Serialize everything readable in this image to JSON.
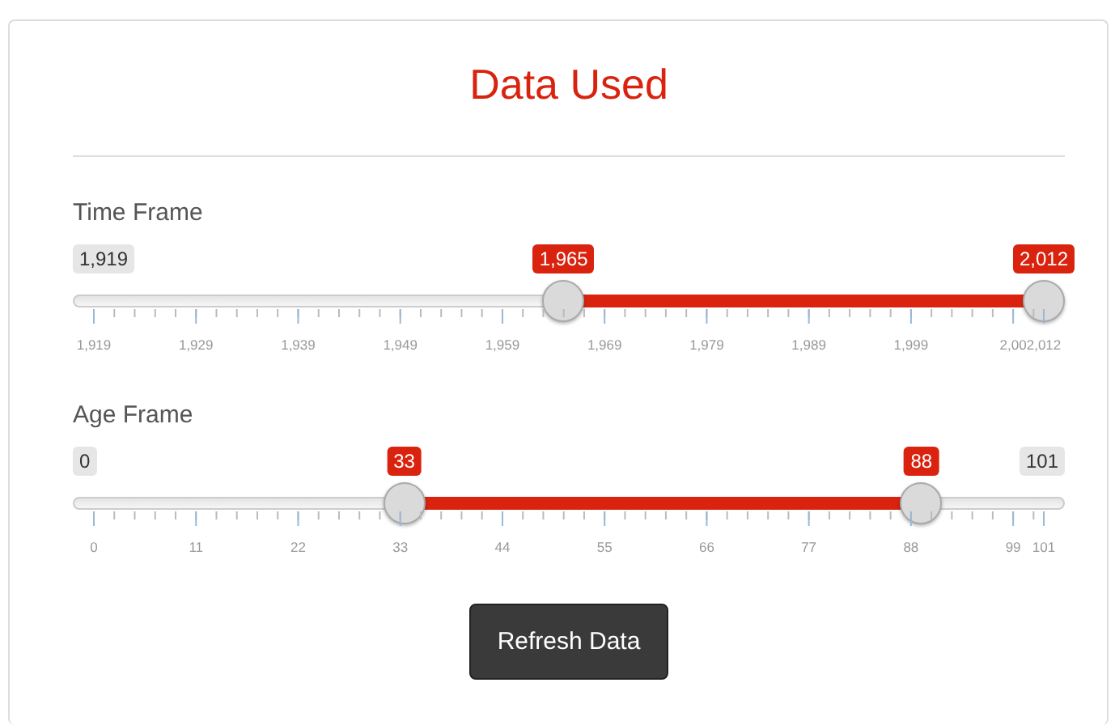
{
  "title": "Data Used",
  "sliders": [
    {
      "label": "Time Frame",
      "min_label": "1,919",
      "handles": [
        {
          "value": "1,965",
          "level": 0.4946
        },
        {
          "value": "2,012",
          "level": 1
        }
      ],
      "ticks": [
        "1,919",
        "1,929",
        "1,939",
        "1,949",
        "1,959",
        "1,969",
        "1,979",
        "1,989",
        "1,999",
        "2,00",
        "2,012"
      ]
    },
    {
      "label": "Age Frame",
      "min_label": "0",
      "max_label": "101",
      "handles": [
        {
          "value": "33",
          "level": 0.3267
        },
        {
          "value": "88",
          "level": 0.8713
        }
      ],
      "ticks": [
        "0",
        "11",
        "22",
        "33",
        "44",
        "55",
        "66",
        "77",
        "88",
        "99",
        "101"
      ]
    }
  ],
  "button": "Refresh Data"
}
